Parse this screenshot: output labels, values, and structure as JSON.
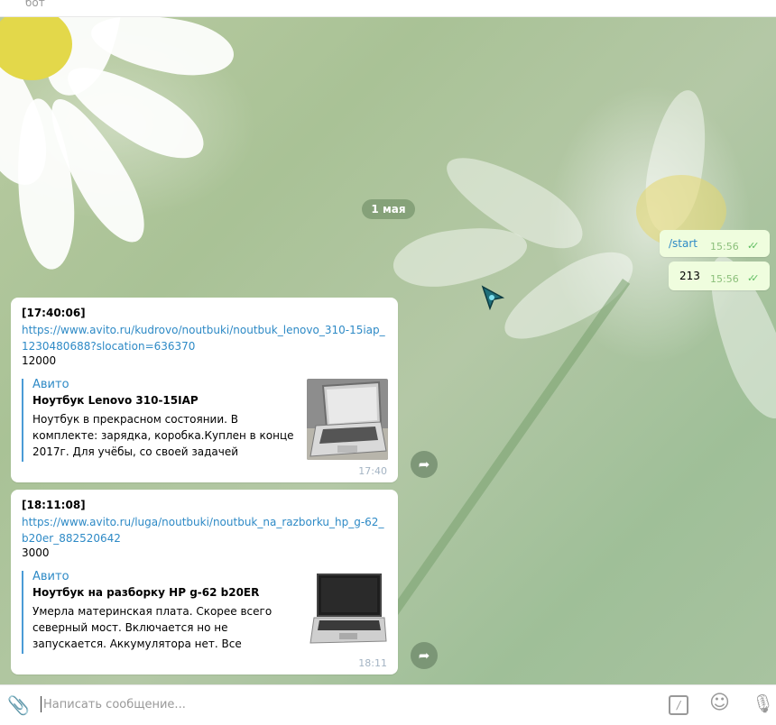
{
  "header": {
    "status": "бот"
  },
  "date_pill": "1 мая",
  "outgoing": [
    {
      "text": "/start",
      "time": "15:56",
      "is_command": true
    },
    {
      "text": "213",
      "time": "15:56",
      "is_command": false
    }
  ],
  "incoming": [
    {
      "timestamp": "[17:40:06]",
      "url": "https://www.avito.ru/kudrovo/noutbuki/noutbuk_lenovo_310-15iap_1230480688?slocation=636370",
      "price": "12000",
      "preview": {
        "site": "Авито",
        "title": "Ноутбук Lenovo 310-15IAP",
        "description": "Ноутбук в прекрасном состоянии. В комплекте: зарядка, коробка.Куплен в конце 2017г. Для учёбы, со своей задачей справляет..."
      },
      "time": "17:40"
    },
    {
      "timestamp": "[18:11:08]",
      "url": "https://www.avito.ru/luga/noutbuki/noutbuk_na_razborku_hp_g-62_b20er_882520642",
      "price": "3000",
      "preview": {
        "site": "Авито",
        "title": "Ноутбук на разборку HP g-62 b20ER",
        "description": "Умерла материнская плата. Скорее всего северный мост. Включается но не запускается. Аккумулятора нет. Все остальное есть. Без ОЗ..."
      },
      "time": "18:11"
    }
  ],
  "composer": {
    "placeholder": "Написать сообщение..."
  },
  "colors": {
    "accent": "#2e8ac6",
    "outgoing_bubble": "#effdde",
    "checks": "#5fbe62"
  }
}
